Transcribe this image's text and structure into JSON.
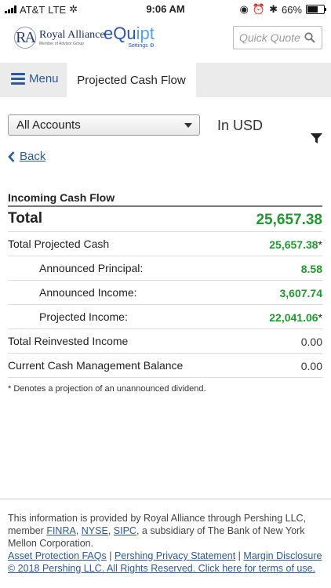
{
  "status_bar": {
    "carrier": "AT&T",
    "network": "LTE",
    "time": "9:06 AM",
    "battery": "66%",
    "battery_level": 0.66
  },
  "header": {
    "logo_monogram": "RA",
    "logo_name": "Royal Alliance",
    "logo_tagline": "Member of Advisor Group",
    "equipt_prefix": "eQu",
    "equipt_suffix": "ipt",
    "settings_label": "Settings",
    "quick_quote_placeholder": "Quick Quote"
  },
  "nav": {
    "menu_label": "Menu",
    "active_tab": "Projected Cash Flow"
  },
  "filters": {
    "account_selected": "All Accounts",
    "currency": "In USD"
  },
  "back_label": "Back",
  "section_title": "Incoming Cash Flow",
  "rows": [
    {
      "label": "Total",
      "value": "25,657.38",
      "marker": ""
    },
    {
      "label": "Total Projected Cash",
      "value": "25,657.38",
      "marker": "*"
    },
    {
      "label": "Announced Principal:",
      "value": "8.58",
      "marker": ""
    },
    {
      "label": "Announced Income:",
      "value": "3,607.74",
      "marker": ""
    },
    {
      "label": "Projected Income:",
      "value": "22,041.06",
      "marker": "*"
    },
    {
      "label": "Total Reinvested Income",
      "value": "0.00",
      "marker": ""
    },
    {
      "label": "Current Cash Management Balance",
      "value": "0.00",
      "marker": ""
    }
  ],
  "footnote": "* Denotes a projection of an unannounced dividend.",
  "footer": {
    "text_before_links": "This information is provided by Royal Alliance through Pershing LLC, member ",
    "finra": "FINRA",
    "comma1": ", ",
    "nyse": "NYSE",
    "comma2": ", ",
    "sipc": "SIPC",
    "text_after_links": ", a subsidiary of The Bank of New York Mellon Corporation.",
    "asset_faq": "Asset Protection FAQs",
    "sep": " | ",
    "privacy": "Pershing Privacy Statement",
    "margin": "Margin Disclosure",
    "copyright": "© 2018 Pershing LLC. All Rights Reserved. Click here for terms of use."
  },
  "colors": {
    "accent": "#2a5a9a",
    "positive": "#1f9a2e",
    "nav_bg": "#ebebeb"
  }
}
